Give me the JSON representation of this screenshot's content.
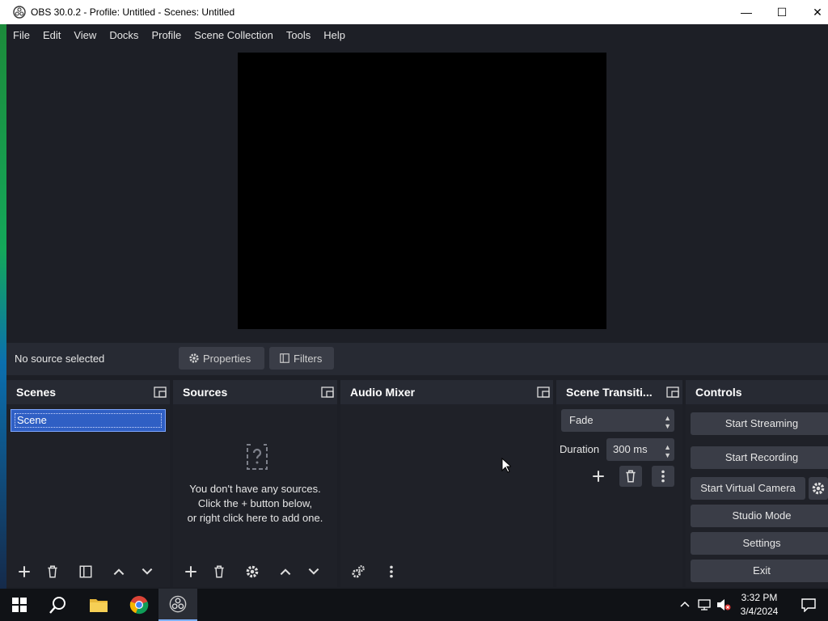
{
  "window": {
    "title": "OBS 30.0.2 - Profile: Untitled - Scenes: Untitled"
  },
  "window_controls": {
    "minimize": "—",
    "maximize": "☐",
    "close": "✕"
  },
  "menu": [
    "File",
    "Edit",
    "View",
    "Docks",
    "Profile",
    "Scene Collection",
    "Tools",
    "Help"
  ],
  "context_bar": {
    "status": "No source selected",
    "properties_label": "Properties",
    "filters_label": "Filters"
  },
  "docks": {
    "scenes": {
      "title": "Scenes",
      "items": [
        "Scene"
      ]
    },
    "sources": {
      "title": "Sources",
      "empty_lines": [
        "You don't have any sources.",
        "Click the + button below,",
        "or right click here to add one."
      ]
    },
    "audio_mixer": {
      "title": "Audio Mixer"
    },
    "transitions": {
      "title": "Scene Transiti...",
      "selected": "Fade",
      "duration_label": "Duration",
      "duration_value": "300 ms"
    },
    "controls": {
      "title": "Controls",
      "start_streaming": "Start Streaming",
      "start_recording": "Start Recording",
      "start_virtual_camera": "Start Virtual Camera",
      "studio_mode": "Studio Mode",
      "settings": "Settings",
      "exit": "Exit"
    }
  },
  "taskbar": {
    "time": "3:32 PM",
    "date": "3/4/2024"
  },
  "colors": {
    "accent": "#2f5fc4",
    "window_bg": "#1d1f26",
    "dock_bg": "#272a33",
    "button_bg": "#3a3d47"
  }
}
